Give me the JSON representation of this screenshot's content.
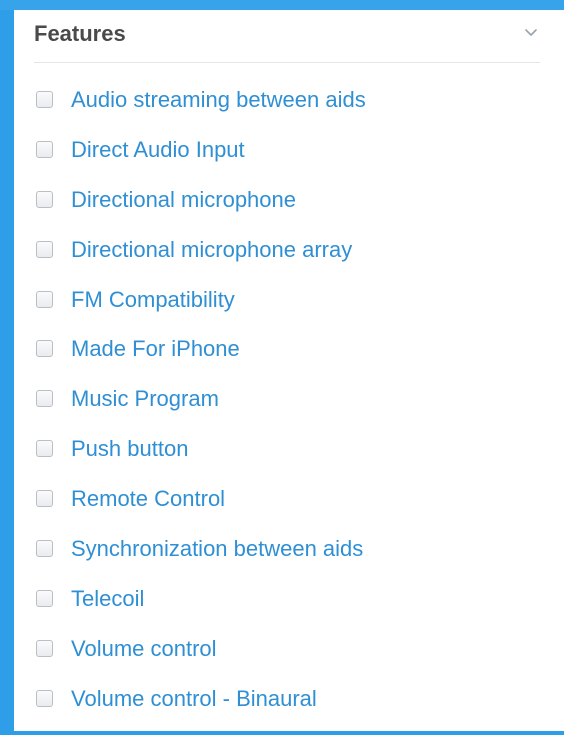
{
  "filter": {
    "title": "Features",
    "collapse_icon": "chevron-down-icon",
    "items": [
      {
        "label": "Audio streaming between aids",
        "checked": false
      },
      {
        "label": "Direct Audio Input",
        "checked": false
      },
      {
        "label": "Directional microphone",
        "checked": false
      },
      {
        "label": "Directional microphone array",
        "checked": false
      },
      {
        "label": "FM Compatibility",
        "checked": false
      },
      {
        "label": "Made For iPhone",
        "checked": false
      },
      {
        "label": "Music Program",
        "checked": false
      },
      {
        "label": "Push button",
        "checked": false
      },
      {
        "label": "Remote Control",
        "checked": false
      },
      {
        "label": "Synchronization between aids",
        "checked": false
      },
      {
        "label": "Telecoil",
        "checked": false
      },
      {
        "label": "Volume control",
        "checked": false
      },
      {
        "label": "Volume control - Binaural",
        "checked": false
      }
    ]
  },
  "colors": {
    "background": "#2f9ee8",
    "panel": "#ffffff",
    "title": "#4a4a4a",
    "link": "#2f8fd4",
    "divider": "#e2e6ea"
  }
}
